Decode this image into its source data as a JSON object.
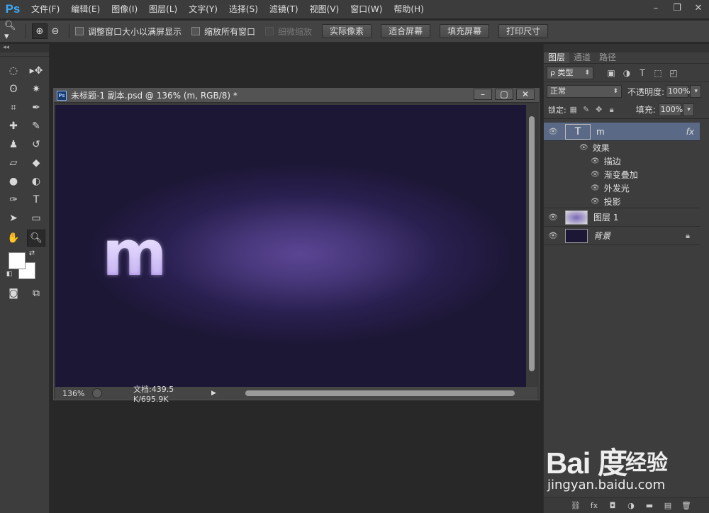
{
  "app": {
    "logo": "Ps"
  },
  "menu": [
    "文件(F)",
    "编辑(E)",
    "图像(I)",
    "图层(L)",
    "文字(Y)",
    "选择(S)",
    "滤镜(T)",
    "视图(V)",
    "窗口(W)",
    "帮助(H)"
  ],
  "window_controls": [
    "–",
    "❐",
    "✕"
  ],
  "options_bar": {
    "fit_window": "调整窗口大小以满屏显示",
    "zoom_all": "缩放所有窗口",
    "scrubby_zoom": "细微缩放",
    "buttons": [
      "实际像素",
      "适合屏幕",
      "填充屏幕",
      "打印尺寸"
    ]
  },
  "toolbar": {
    "collapse": "◂◂"
  },
  "document": {
    "title": "未标题-1 副本.psd @ 136% (m, RGB/8) *",
    "ps_badge": "Ps",
    "canvas_text": "m",
    "zoom": "136%",
    "doc_size": "文档:439.5 K/695.9K"
  },
  "layers_panel": {
    "tabs": [
      "图层",
      "通道",
      "路径"
    ],
    "filter_kind": "ρ 类型",
    "blend_mode": "正常",
    "opacity_label": "不透明度:",
    "opacity_value": "100%",
    "lock_label": "锁定:",
    "fill_label": "填充:",
    "fill_value": "100%",
    "layers": [
      {
        "name": "m",
        "type": "text",
        "fx": "fx",
        "selected": true
      },
      {
        "name": "图层 1",
        "type": "pixel"
      },
      {
        "name": "背景",
        "type": "background",
        "locked": true
      }
    ],
    "effects_label": "效果",
    "effects": [
      "描边",
      "渐变叠加",
      "外发光",
      "投影"
    ]
  },
  "watermark": {
    "brand": "Bai 度",
    "product": "经验",
    "url": "jingyan.baidu.com"
  },
  "colors": {
    "accent": "#3fa9f5",
    "canvas": "#2a2050",
    "selected_layer": "#5a6a86"
  }
}
